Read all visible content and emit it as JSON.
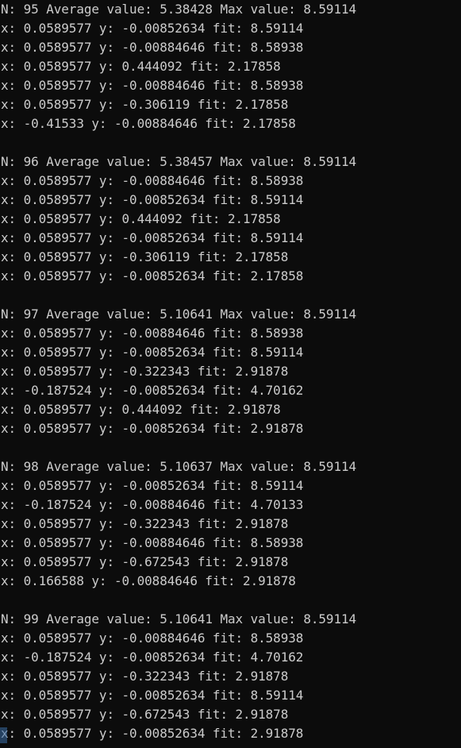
{
  "console": {
    "blocks": [
      {
        "header": "N: 95 Average value: 5.38428 Max value: 8.59114",
        "lines": [
          "x: 0.0589577 y: -0.00852634 fit: 8.59114",
          "x: 0.0589577 y: -0.00884646 fit: 8.58938",
          "x: 0.0589577 y: 0.444092 fit: 2.17858",
          "x: 0.0589577 y: -0.00884646 fit: 8.58938",
          "x: 0.0589577 y: -0.306119 fit: 2.17858",
          "x: -0.41533 y: -0.00884646 fit: 2.17858"
        ]
      },
      {
        "header": "N: 96 Average value: 5.38457 Max value: 8.59114",
        "lines": [
          "x: 0.0589577 y: -0.00884646 fit: 8.58938",
          "x: 0.0589577 y: -0.00852634 fit: 8.59114",
          "x: 0.0589577 y: 0.444092 fit: 2.17858",
          "x: 0.0589577 y: -0.00852634 fit: 8.59114",
          "x: 0.0589577 y: -0.306119 fit: 2.17858",
          "x: 0.0589577 y: -0.00852634 fit: 2.17858"
        ]
      },
      {
        "header": "N: 97 Average value: 5.10641 Max value: 8.59114",
        "lines": [
          "x: 0.0589577 y: -0.00884646 fit: 8.58938",
          "x: 0.0589577 y: -0.00852634 fit: 8.59114",
          "x: 0.0589577 y: -0.322343 fit: 2.91878",
          "x: -0.187524 y: -0.00852634 fit: 4.70162",
          "x: 0.0589577 y: 0.444092 fit: 2.91878",
          "x: 0.0589577 y: -0.00852634 fit: 2.91878"
        ]
      },
      {
        "header": "N: 98 Average value: 5.10637 Max value: 8.59114",
        "lines": [
          "x: 0.0589577 y: -0.00852634 fit: 8.59114",
          "x: -0.187524 y: -0.00884646 fit: 4.70133",
          "x: 0.0589577 y: -0.322343 fit: 2.91878",
          "x: 0.0589577 y: -0.00884646 fit: 8.58938",
          "x: 0.0589577 y: -0.672543 fit: 2.91878",
          "x: 0.166588 y: -0.00884646 fit: 2.91878"
        ]
      },
      {
        "header": "N: 99 Average value: 5.10641 Max value: 8.59114",
        "lines": [
          "x: 0.0589577 y: -0.00884646 fit: 8.58938",
          "x: -0.187524 y: -0.00852634 fit: 4.70162",
          "x: 0.0589577 y: -0.322343 fit: 2.91878",
          "x: 0.0589577 y: -0.00852634 fit: 8.59114",
          "x: 0.0589577 y: -0.672543 fit: 2.91878",
          "x: 0.0589577 y: -0.00852634 fit: 2.91878"
        ]
      }
    ]
  },
  "colors": {
    "background": "#0c0c0c",
    "text": "#cccccc",
    "cursor": "#3a6ea5"
  }
}
